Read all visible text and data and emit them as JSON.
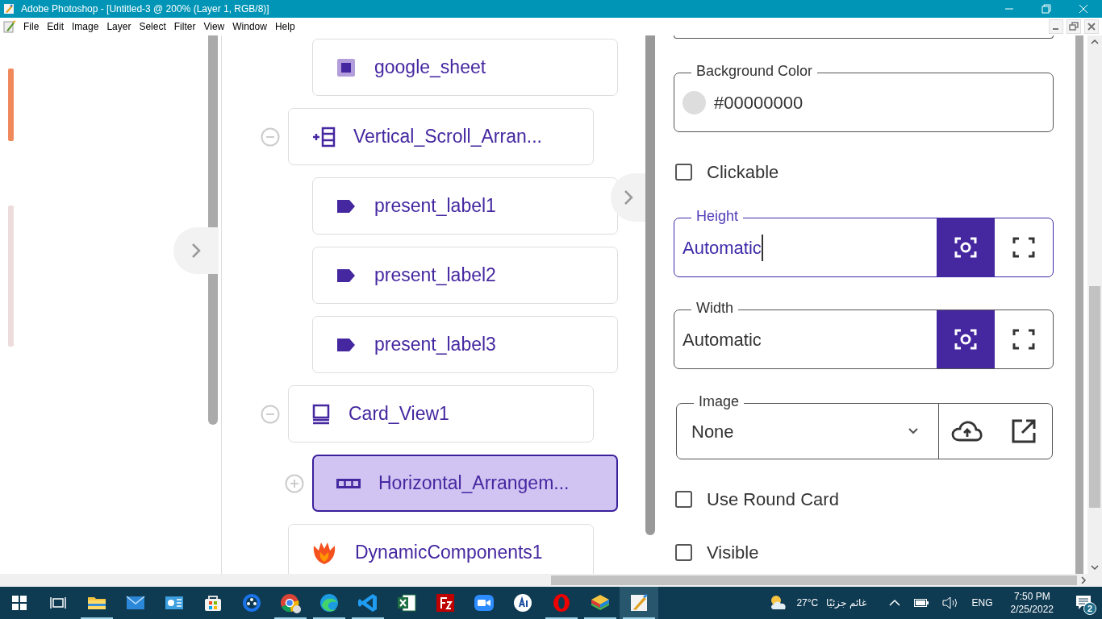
{
  "window": {
    "title": "Adobe Photoshop - [Untitled-3 @ 200% (Layer 1, RGB/8)]"
  },
  "menu": [
    "File",
    "Edit",
    "Image",
    "Layer",
    "Select",
    "Filter",
    "View",
    "Window",
    "Help"
  ],
  "tree": [
    {
      "children": [
        {
          "label": "google_sheet",
          "kind": "component",
          "selected": false
        }
      ]
    },
    {
      "label": "Vertical_Scroll_Arran...",
      "kind": "vertical",
      "expanded": true,
      "selected": false,
      "children": [
        {
          "label": "present_label1",
          "kind": "label",
          "selected": false
        },
        {
          "label": "present_label2",
          "kind": "label",
          "selected": false
        },
        {
          "label": "present_label3",
          "kind": "label",
          "selected": false
        }
      ]
    },
    {
      "label": "Card_View1",
      "kind": "card",
      "expanded": true,
      "selected": false,
      "children": [
        {
          "label": "Horizontal_Arrangem...",
          "kind": "horizontal",
          "expanded": false,
          "selected": true
        }
      ]
    },
    {
      "label": "DynamicComponents1",
      "kind": "dynamic",
      "selected": false
    }
  ],
  "properties": [
    {
      "kind": "color",
      "label": "Background Color",
      "value": "#00000000"
    },
    {
      "kind": "checkbox",
      "label": "Clickable",
      "checked": false
    },
    {
      "kind": "size",
      "label": "Height",
      "value": "Automatic",
      "focused": true
    },
    {
      "kind": "size",
      "label": "Width",
      "value": "Automatic",
      "focused": false
    },
    {
      "kind": "select",
      "label": "Image",
      "value": "None"
    },
    {
      "kind": "checkbox",
      "label": "Use Round Card",
      "checked": false
    },
    {
      "kind": "checkbox",
      "label": "Visible",
      "checked": false
    }
  ],
  "taskbar": {
    "apps": [
      {
        "kind": "files",
        "running": true,
        "active": false
      },
      {
        "kind": "mail",
        "running": false,
        "active": false
      },
      {
        "kind": "panel",
        "running": false,
        "active": false
      },
      {
        "kind": "store",
        "running": false,
        "active": false
      },
      {
        "kind": "reel",
        "running": false,
        "active": false
      },
      {
        "kind": "chrome",
        "running": true,
        "active": false
      },
      {
        "kind": "edge",
        "running": true,
        "active": false
      },
      {
        "kind": "code",
        "running": true,
        "active": false
      },
      {
        "kind": "excel",
        "running": false,
        "active": false
      },
      {
        "kind": "fz",
        "running": false,
        "active": false
      },
      {
        "kind": "camera",
        "running": false,
        "active": false
      },
      {
        "kind": "ai",
        "running": false,
        "active": false
      },
      {
        "kind": "opera",
        "running": true,
        "active": false
      },
      {
        "kind": "stack",
        "running": true,
        "active": false
      },
      {
        "kind": "brush",
        "running": true,
        "active": true
      }
    ],
    "weather": {
      "temperature": "27°C",
      "condition": "غائم جزئيًا"
    },
    "language": "ENG",
    "time": "7:50 PM",
    "date": "2/25/2022",
    "notifications": "2"
  }
}
